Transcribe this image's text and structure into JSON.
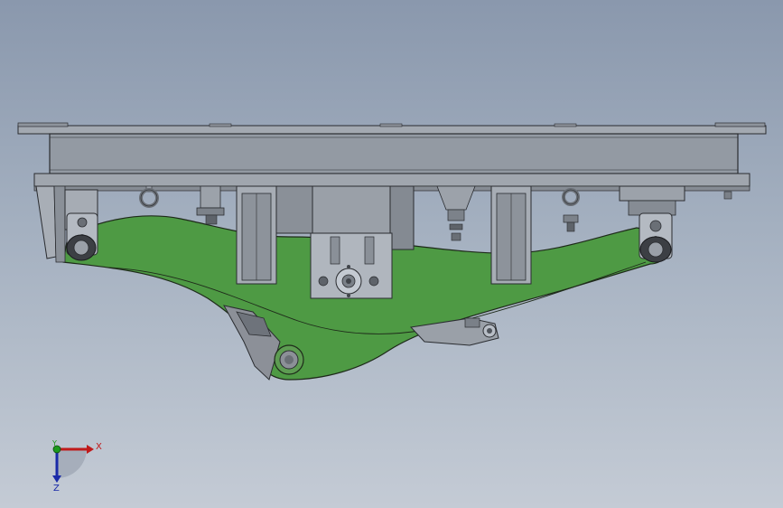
{
  "viewport": {
    "background_top": "#8a98ad",
    "background_bottom": "#c4cbd5"
  },
  "model": {
    "frame_color": "#9aa0a8",
    "arm_color": "#4e9a44",
    "edge_color": "#2a2c30"
  },
  "triad": {
    "x_label": "X",
    "y_label": "Y",
    "z_label": "Z",
    "x_color": "#c01a1a",
    "y_color": "#1c9a1c",
    "z_color": "#1a2aa8"
  }
}
